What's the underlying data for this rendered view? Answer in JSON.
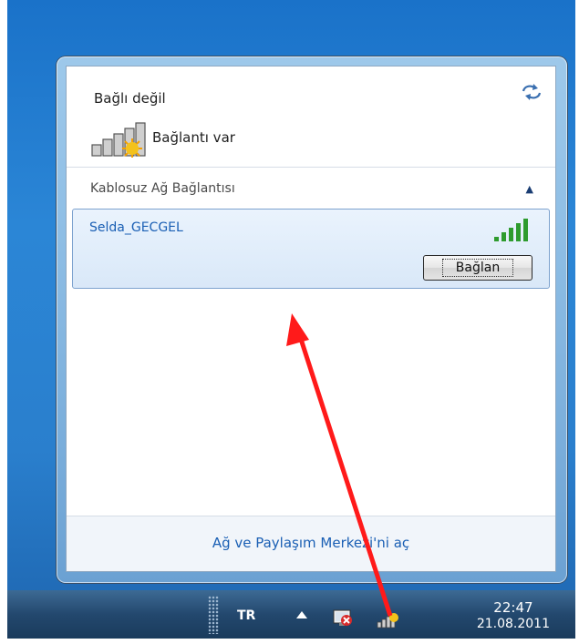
{
  "flyout": {
    "status_title": "Bağlı değil",
    "connection_status": "Bağlantı var",
    "section_header": "Kablosuz Ağ Bağlantısı",
    "networks": [
      {
        "name": "Selda_GECGEL",
        "signal_bars": 5,
        "connect_label": "Bağlan"
      }
    ],
    "footer_link": "Ağ ve Paylaşım Merkezi'ni aç"
  },
  "taskbar": {
    "language": "TR",
    "time": "22:47",
    "date": "21.08.2011"
  },
  "colors": {
    "desktop": "#2b86d6",
    "link": "#1a5fb4",
    "signal": "#2e9b2e",
    "arrow": "#ff1a1a"
  },
  "icons": {
    "refresh": "refresh-icon",
    "bars": "wireless-bars-icon",
    "collapse": "chevron-up-icon",
    "signal": "signal-strength-icon",
    "tray_up": "show-hidden-icons-icon",
    "tray_action": "action-center-icon",
    "tray_network": "network-tray-icon"
  }
}
